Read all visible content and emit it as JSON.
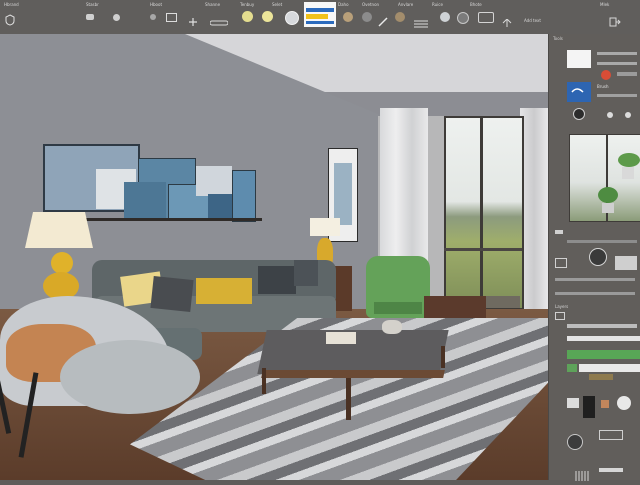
{
  "toolbar": {
    "labels": [
      "Hbrand",
      "Stasbr",
      "Hboot",
      "Shanne",
      "Tenbuy",
      "Selet",
      "Daho",
      "Ovetnon",
      "Anvlare",
      "Ruice",
      "Bhote",
      "Mlek"
    ],
    "right_label": "Add text"
  },
  "panel": {
    "tools_group_label": "Tools",
    "brush_label": "Brush",
    "layers_label": "Layers"
  }
}
